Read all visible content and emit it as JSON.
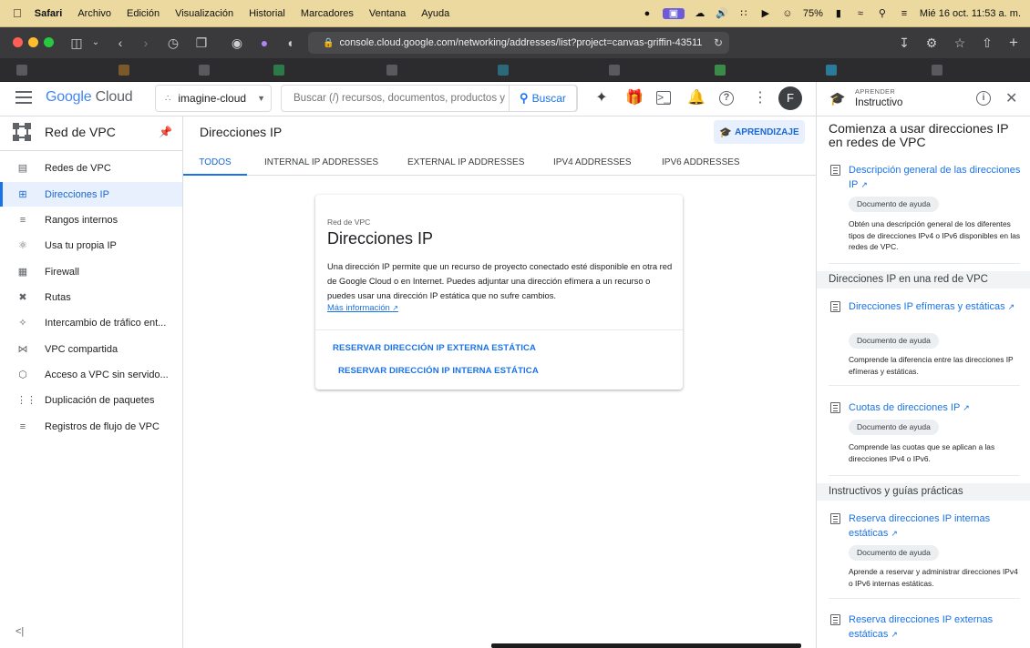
{
  "menubar": {
    "app": "Safari",
    "items": [
      "Archivo",
      "Edición",
      "Visualización",
      "Historial",
      "Marcadores",
      "Ventana",
      "Ayuda"
    ],
    "battery": "75%",
    "datetime": "Mié 16 oct.  11:53 a. m."
  },
  "browser": {
    "url": "console.cloud.google.com/networking/addresses/list?project=canvas-griffin-43511"
  },
  "header": {
    "logo_google": "Google",
    "logo_cloud": "Cloud",
    "project": "imagine-cloud",
    "search_placeholder": "Buscar (/) recursos, documentos, productos y ...",
    "search_button": "Buscar",
    "avatar_letter": "F"
  },
  "nav": {
    "title": "Red de VPC",
    "items": [
      {
        "label": "Redes de VPC",
        "icon": "network-icon"
      },
      {
        "label": "Direcciones IP",
        "icon": "ip-address-icon"
      },
      {
        "label": "Rangos internos",
        "icon": "range-icon"
      },
      {
        "label": "Usa tu propia IP",
        "icon": "globe-icon"
      },
      {
        "label": "Firewall",
        "icon": "firewall-icon"
      },
      {
        "label": "Rutas",
        "icon": "routes-icon"
      },
      {
        "label": "Intercambio de tráfico ent...",
        "icon": "peering-icon"
      },
      {
        "label": "VPC compartida",
        "icon": "shared-vpc-icon"
      },
      {
        "label": "Acceso a VPC sin servido...",
        "icon": "serverless-icon"
      },
      {
        "label": "Duplicación de paquetes",
        "icon": "packet-mirroring-icon"
      },
      {
        "label": "Registros de flujo de VPC",
        "icon": "flow-logs-icon"
      }
    ]
  },
  "main": {
    "page_title": "Direcciones IP",
    "learn_button": "APRENDIZAJE",
    "tabs": [
      "TODOS",
      "INTERNAL IP ADDRESSES",
      "EXTERNAL IP ADDRESSES",
      "IPV4 ADDRESSES",
      "IPV6 ADDRESSES"
    ],
    "card": {
      "eyebrow": "Red de VPC",
      "title": "Direcciones IP",
      "body": "Una dirección IP permite que un recurso de proyecto conectado esté disponible en otra red de Google Cloud o en Internet. Puedes adjuntar una dirección efímera a un recurso o puedes usar una dirección IP estática que no sufre cambios.",
      "link": "Más información",
      "action_external": "RESERVAR DIRECCIÓN IP EXTERNA ESTÁTICA",
      "action_internal": "RESERVAR DIRECCIÓN IP INTERNA ESTÁTICA"
    }
  },
  "panel": {
    "eyebrow": "APRENDER",
    "title": "Instructivo",
    "heading": "Comienza a usar direcciones IP en redes de VPC",
    "chip": "Documento de ayuda",
    "sections": [
      "Direcciones IP en una red de VPC",
      "Instructivos y guías prácticas"
    ],
    "items": [
      {
        "title": "Descripción general de las direcciones IP",
        "desc": "Obtén una descripción general de los diferentes tipos de direcciones IPv4 o IPv6 disponibles en las redes de VPC."
      },
      {
        "title": "Direcciones IP efímeras y estáticas",
        "desc": "Comprende la diferencia entre las direcciones IP efímeras y estáticas."
      },
      {
        "title": "Cuotas de direcciones IP",
        "desc": "Comprende las cuotas que se aplican a las direcciones IPv4 o IPv6."
      },
      {
        "title": "Reserva direcciones IP internas estáticas",
        "desc": "Aprende a reservar y administrar direcciones IPv4 o IPv6 internas estáticas."
      },
      {
        "title": "Reserva direcciones IP externas estáticas",
        "desc": ""
      }
    ]
  },
  "colors": {
    "accent": "#1a73e8",
    "menubar": "#ecd9a0",
    "safari_toolbar": "#3a3a3c"
  }
}
